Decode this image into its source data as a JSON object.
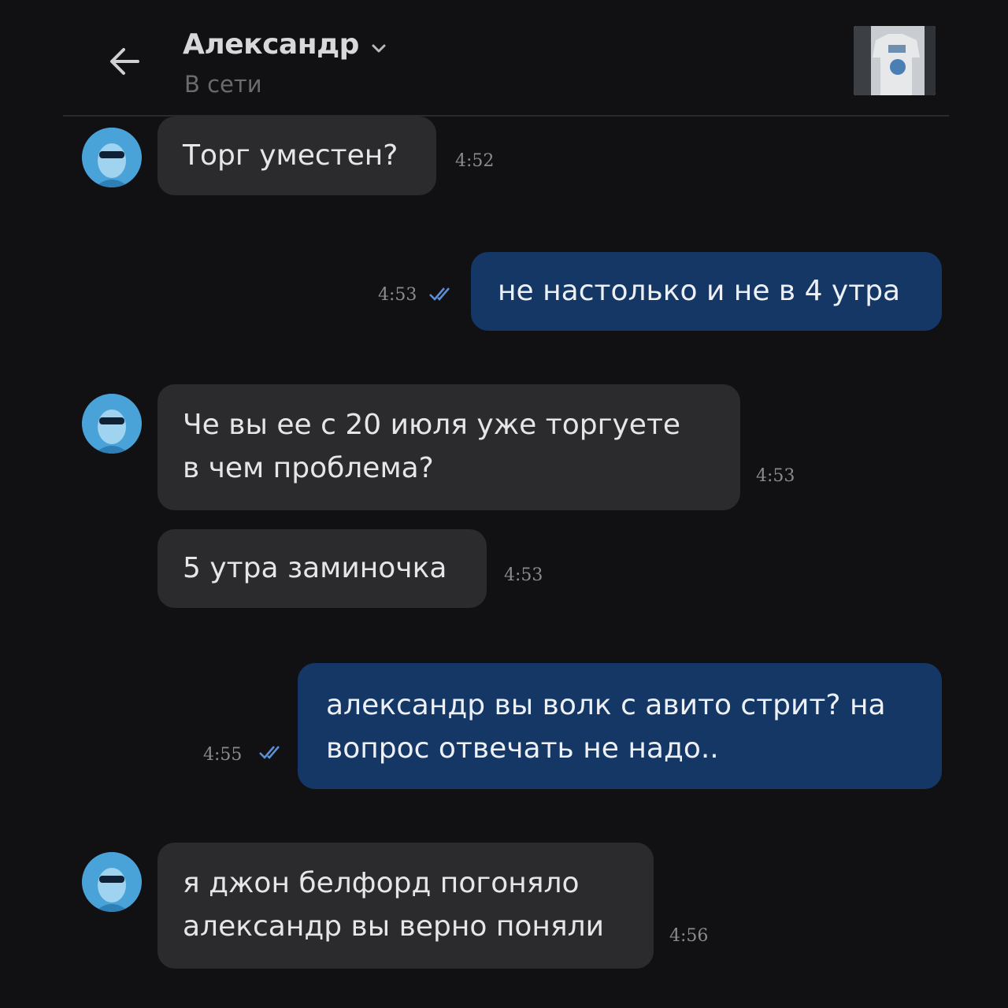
{
  "header": {
    "contact_name": "Александр",
    "status": "В сети"
  },
  "messages": [
    {
      "direction": "in",
      "text": "Торг уместен?",
      "time": "4:52"
    },
    {
      "direction": "out",
      "text": "не настолько и не в 4 утра",
      "time": "4:53",
      "read": true
    },
    {
      "direction": "in",
      "text": "Че вы ее с 20 июля уже торгуете\nв чем проблема?",
      "time": "4:53"
    },
    {
      "direction": "in",
      "text": "5 утра заминочка",
      "time": "4:53"
    },
    {
      "direction": "out",
      "text": "александр вы волк с авито стрит? на\nвопрос отвечать не надо..",
      "time": "4:55",
      "read": true
    },
    {
      "direction": "in",
      "text": "я джон белфорд погоняло\nалександр вы верно поняли",
      "time": "4:56"
    }
  ],
  "icons": {
    "back": "arrow-left-icon",
    "chevron": "chevron-down-icon",
    "read_receipt": "double-check-icon"
  },
  "colors": {
    "background": "#111113",
    "incoming_bubble": "#2b2b2e",
    "outgoing_bubble": "#143765",
    "check_mark": "#5b8fd6"
  }
}
